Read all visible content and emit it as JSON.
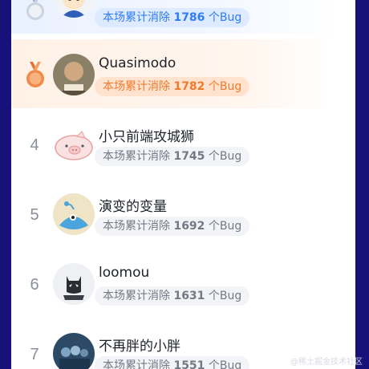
{
  "badge_prefix": "本场累计消除",
  "badge_unit": "个Bug",
  "rows": [
    {
      "rank": "2",
      "name": "",
      "count": "1786",
      "medal": "silver"
    },
    {
      "rank": "3",
      "name": "Quasimodo",
      "count": "1782",
      "medal": "bronze"
    },
    {
      "rank": "4",
      "name": "小只前端攻城狮",
      "count": "1745",
      "medal": ""
    },
    {
      "rank": "5",
      "name": "演变的变量",
      "count": "1692",
      "medal": ""
    },
    {
      "rank": "6",
      "name": "loomou",
      "count": "1631",
      "medal": ""
    },
    {
      "rank": "7",
      "name": "不再胖的小胖",
      "count": "1551",
      "medal": ""
    }
  ],
  "watermark": "@稀土掘金技术社区",
  "colors": {
    "background": "#16127a",
    "silver_accent": "#2f7cf6",
    "bronze_accent": "#f07a2e"
  },
  "icons": {
    "silver_medal": "silver-medal-icon",
    "bronze_medal": "bronze-medal-icon"
  }
}
